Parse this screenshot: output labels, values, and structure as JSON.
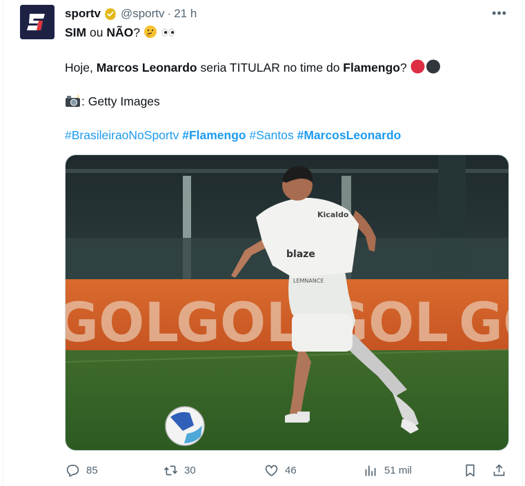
{
  "post": {
    "display_name": "sportv",
    "handle": "@sportv",
    "separator": "·",
    "time": "21 h",
    "more_label": "•••",
    "line1": {
      "strong1": "SIM",
      "mid": " ou ",
      "strong2": "NÃO",
      "end": "?"
    },
    "line2": {
      "prefix": "Hoje, ",
      "name": "Marcos Leonardo",
      "mid": " seria TITULAR no time do ",
      "team": "Flamengo",
      "end": "?"
    },
    "line3": {
      "text": ": Getty Images"
    },
    "hashtags": [
      "#BrasileiraoNoSportv",
      "#Flamengo",
      "#Santos",
      "#MarcosLeonardo"
    ],
    "media": {
      "banner_text": "GOL",
      "shirt_sponsor": "blaze",
      "shirt_brand": "Kicaldo",
      "shirt_lower": "LEMNANCE"
    }
  },
  "actions": {
    "replies": "85",
    "reposts": "30",
    "likes": "46",
    "views": "51 mil"
  },
  "icons": [
    "verified-badge-icon",
    "thinking-face-icon",
    "eyes-icon",
    "red-circle-icon",
    "black-circle-icon",
    "camera-flash-icon",
    "reply-icon",
    "repost-icon",
    "like-icon",
    "views-icon",
    "bookmark-icon",
    "share-icon",
    "more-icon"
  ],
  "colors": {
    "link": "#1d9bf0",
    "muted": "#536471",
    "verified": "#e2b719",
    "avatar_bg": "#1d2245",
    "brand_red": "#e03339"
  }
}
